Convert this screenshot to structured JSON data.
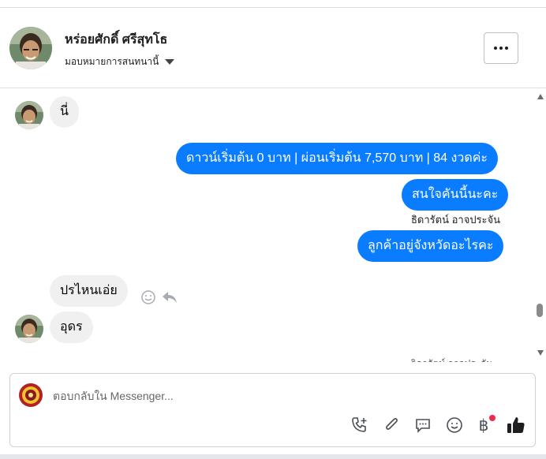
{
  "header": {
    "contact_name": "หร่อยศักดิ์ ศรีสุทโธ",
    "assign_label": "มอบหมายการสนทนานี้"
  },
  "messages": {
    "in_1": "นี่",
    "out_1": "ดาวน์เริ่มต้น 0 บาท | ผ่อนเริ่มต้น 7,570 บาท | 84 งวดค่ะ",
    "out_2": "สนใจคันนี้นะคะ",
    "out_sender": "ธิดารัตน์ อาจประจัน",
    "out_3": "ลูกค้าอยู่จังหวัดอะไรคะ",
    "in_2": "ปรไหนเอ่ย",
    "in_3": "อุดร",
    "faded_sender": "ธิดารัตน์ อาจประจัน"
  },
  "composer": {
    "placeholder": "ตอบกลับใน Messenger..."
  },
  "icons": {
    "more": "more-dots-icon",
    "assign": "caret-down-icon",
    "reaction": "smiley-icon",
    "reply": "reply-arrow-icon",
    "call": "phone-plus-icon",
    "attach": "paperclip-icon",
    "saved_replies": "chat-bubble-icon",
    "emoji": "emoji-icon",
    "payment": "baht-icon",
    "like": "thumbs-up-icon"
  },
  "colors": {
    "outgoing": "#0a7cff",
    "incoming": "#f0f0f0",
    "notification": "#f02849"
  }
}
